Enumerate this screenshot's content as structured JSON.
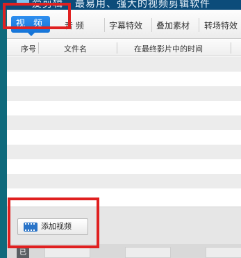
{
  "window": {
    "title": "爱剪辑 - 最易用、强大的视频剪辑软件"
  },
  "tabs": [
    {
      "label": "视 频",
      "active": true
    },
    {
      "label": "音  频",
      "active": false
    },
    {
      "label": "字幕特效",
      "active": false
    },
    {
      "label": "叠加素材",
      "active": false
    },
    {
      "label": "转场特效",
      "active": false
    }
  ],
  "table": {
    "columns": [
      "序号",
      "文件名",
      "在最终影片中的时间"
    ],
    "rows": []
  },
  "actions": {
    "add_video_label": "添加视频"
  },
  "footer": {
    "badge_glyph": "已"
  },
  "colors": {
    "highlight": "#e02020",
    "active_tab": "#1574d8",
    "title_bar": "#0c4c7a"
  }
}
